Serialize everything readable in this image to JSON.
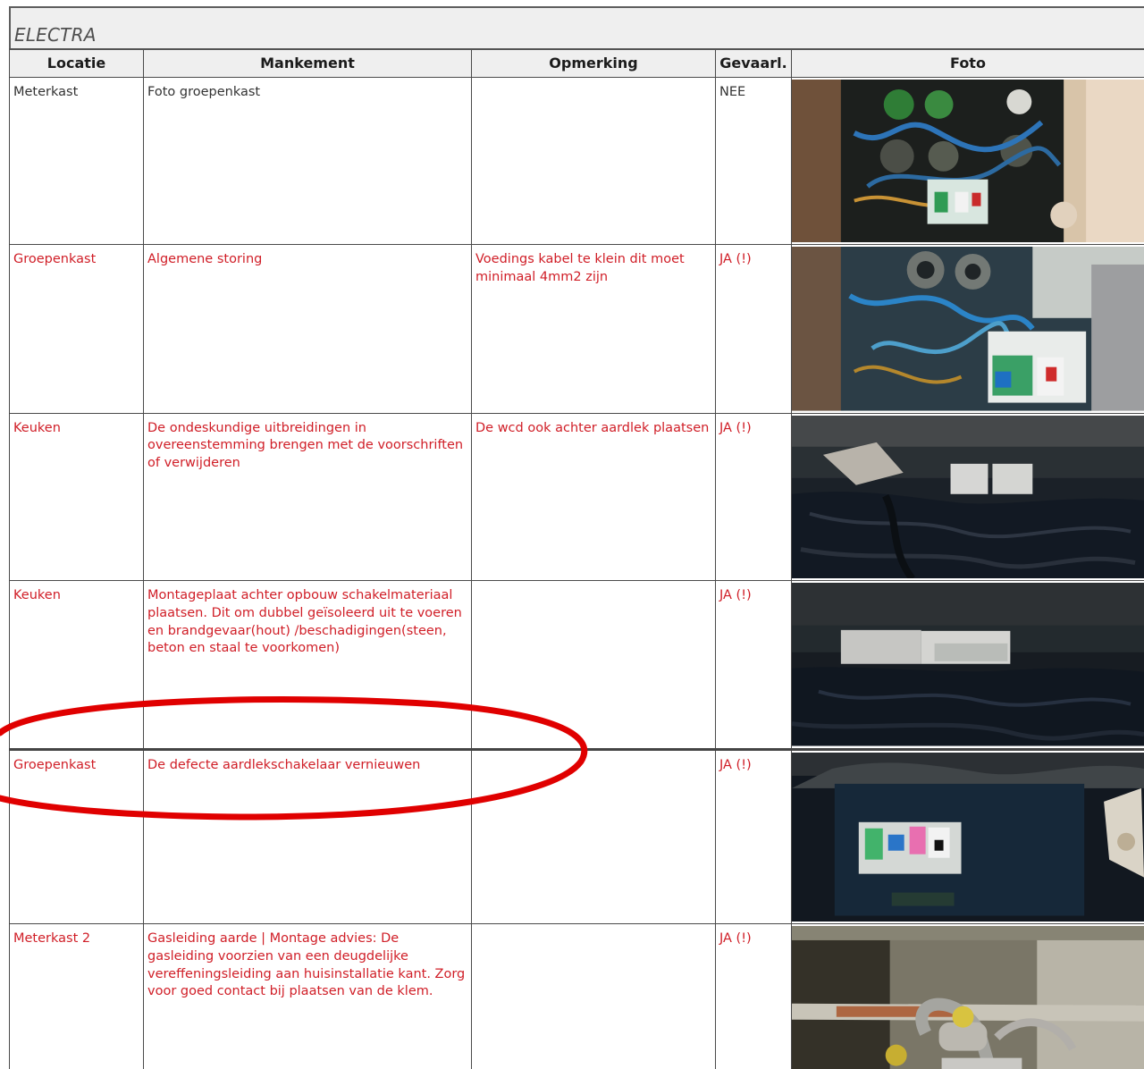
{
  "section": {
    "title": "ELECTRA"
  },
  "table": {
    "columns": [
      "Locatie",
      "Mankement",
      "Opmerking",
      "Gevaarl.",
      "Foto"
    ],
    "rows": [
      {
        "locatie": "Meterkast",
        "mankement": "Foto groepenkast",
        "opmerking": "",
        "gevaarlijk": "NEE"
      },
      {
        "locatie": "Groepenkast",
        "mankement": "Algemene storing",
        "opmerking": "Voedings kabel te klein dit moet minimaal 4mm2 zijn",
        "gevaarlijk": "JA (!)"
      },
      {
        "locatie": "Keuken",
        "mankement": "De ondeskundige uitbreidingen in overeenstemming brengen met de voorschriften of verwijderen",
        "opmerking": "De wcd ook achter aardlek plaatsen",
        "gevaarlijk": "JA (!)"
      },
      {
        "locatie": "Keuken",
        "mankement": "Montageplaat achter opbouw schakelmateriaal plaatsen. Dit om dubbel geïsoleerd uit te voeren en brandgevaar(hout) /beschadigingen(steen, beton en staal te voorkomen)",
        "opmerking": "",
        "gevaarlijk": "JA (!)"
      },
      {
        "locatie": "Groepenkast",
        "mankement": "De defecte aardlekschakelaar vernieuwen",
        "opmerking": "",
        "gevaarlijk": "JA (!)"
      },
      {
        "locatie": "Meterkast 2",
        "mankement": "Gasleiding aarde | Montage advies: De gasleiding voorzien van een deugdelijke vereffeningsleiding aan huisinstallatie kant. Zorg voor goed contact bij plaatsen van de klem.",
        "opmerking": "",
        "gevaarlijk": "JA (!)"
      }
    ]
  },
  "colors": {
    "header_background": "#efefef",
    "defect_text": "#d01e27",
    "normal_text": "#333333",
    "annotation_ellipse": "#e00000"
  }
}
